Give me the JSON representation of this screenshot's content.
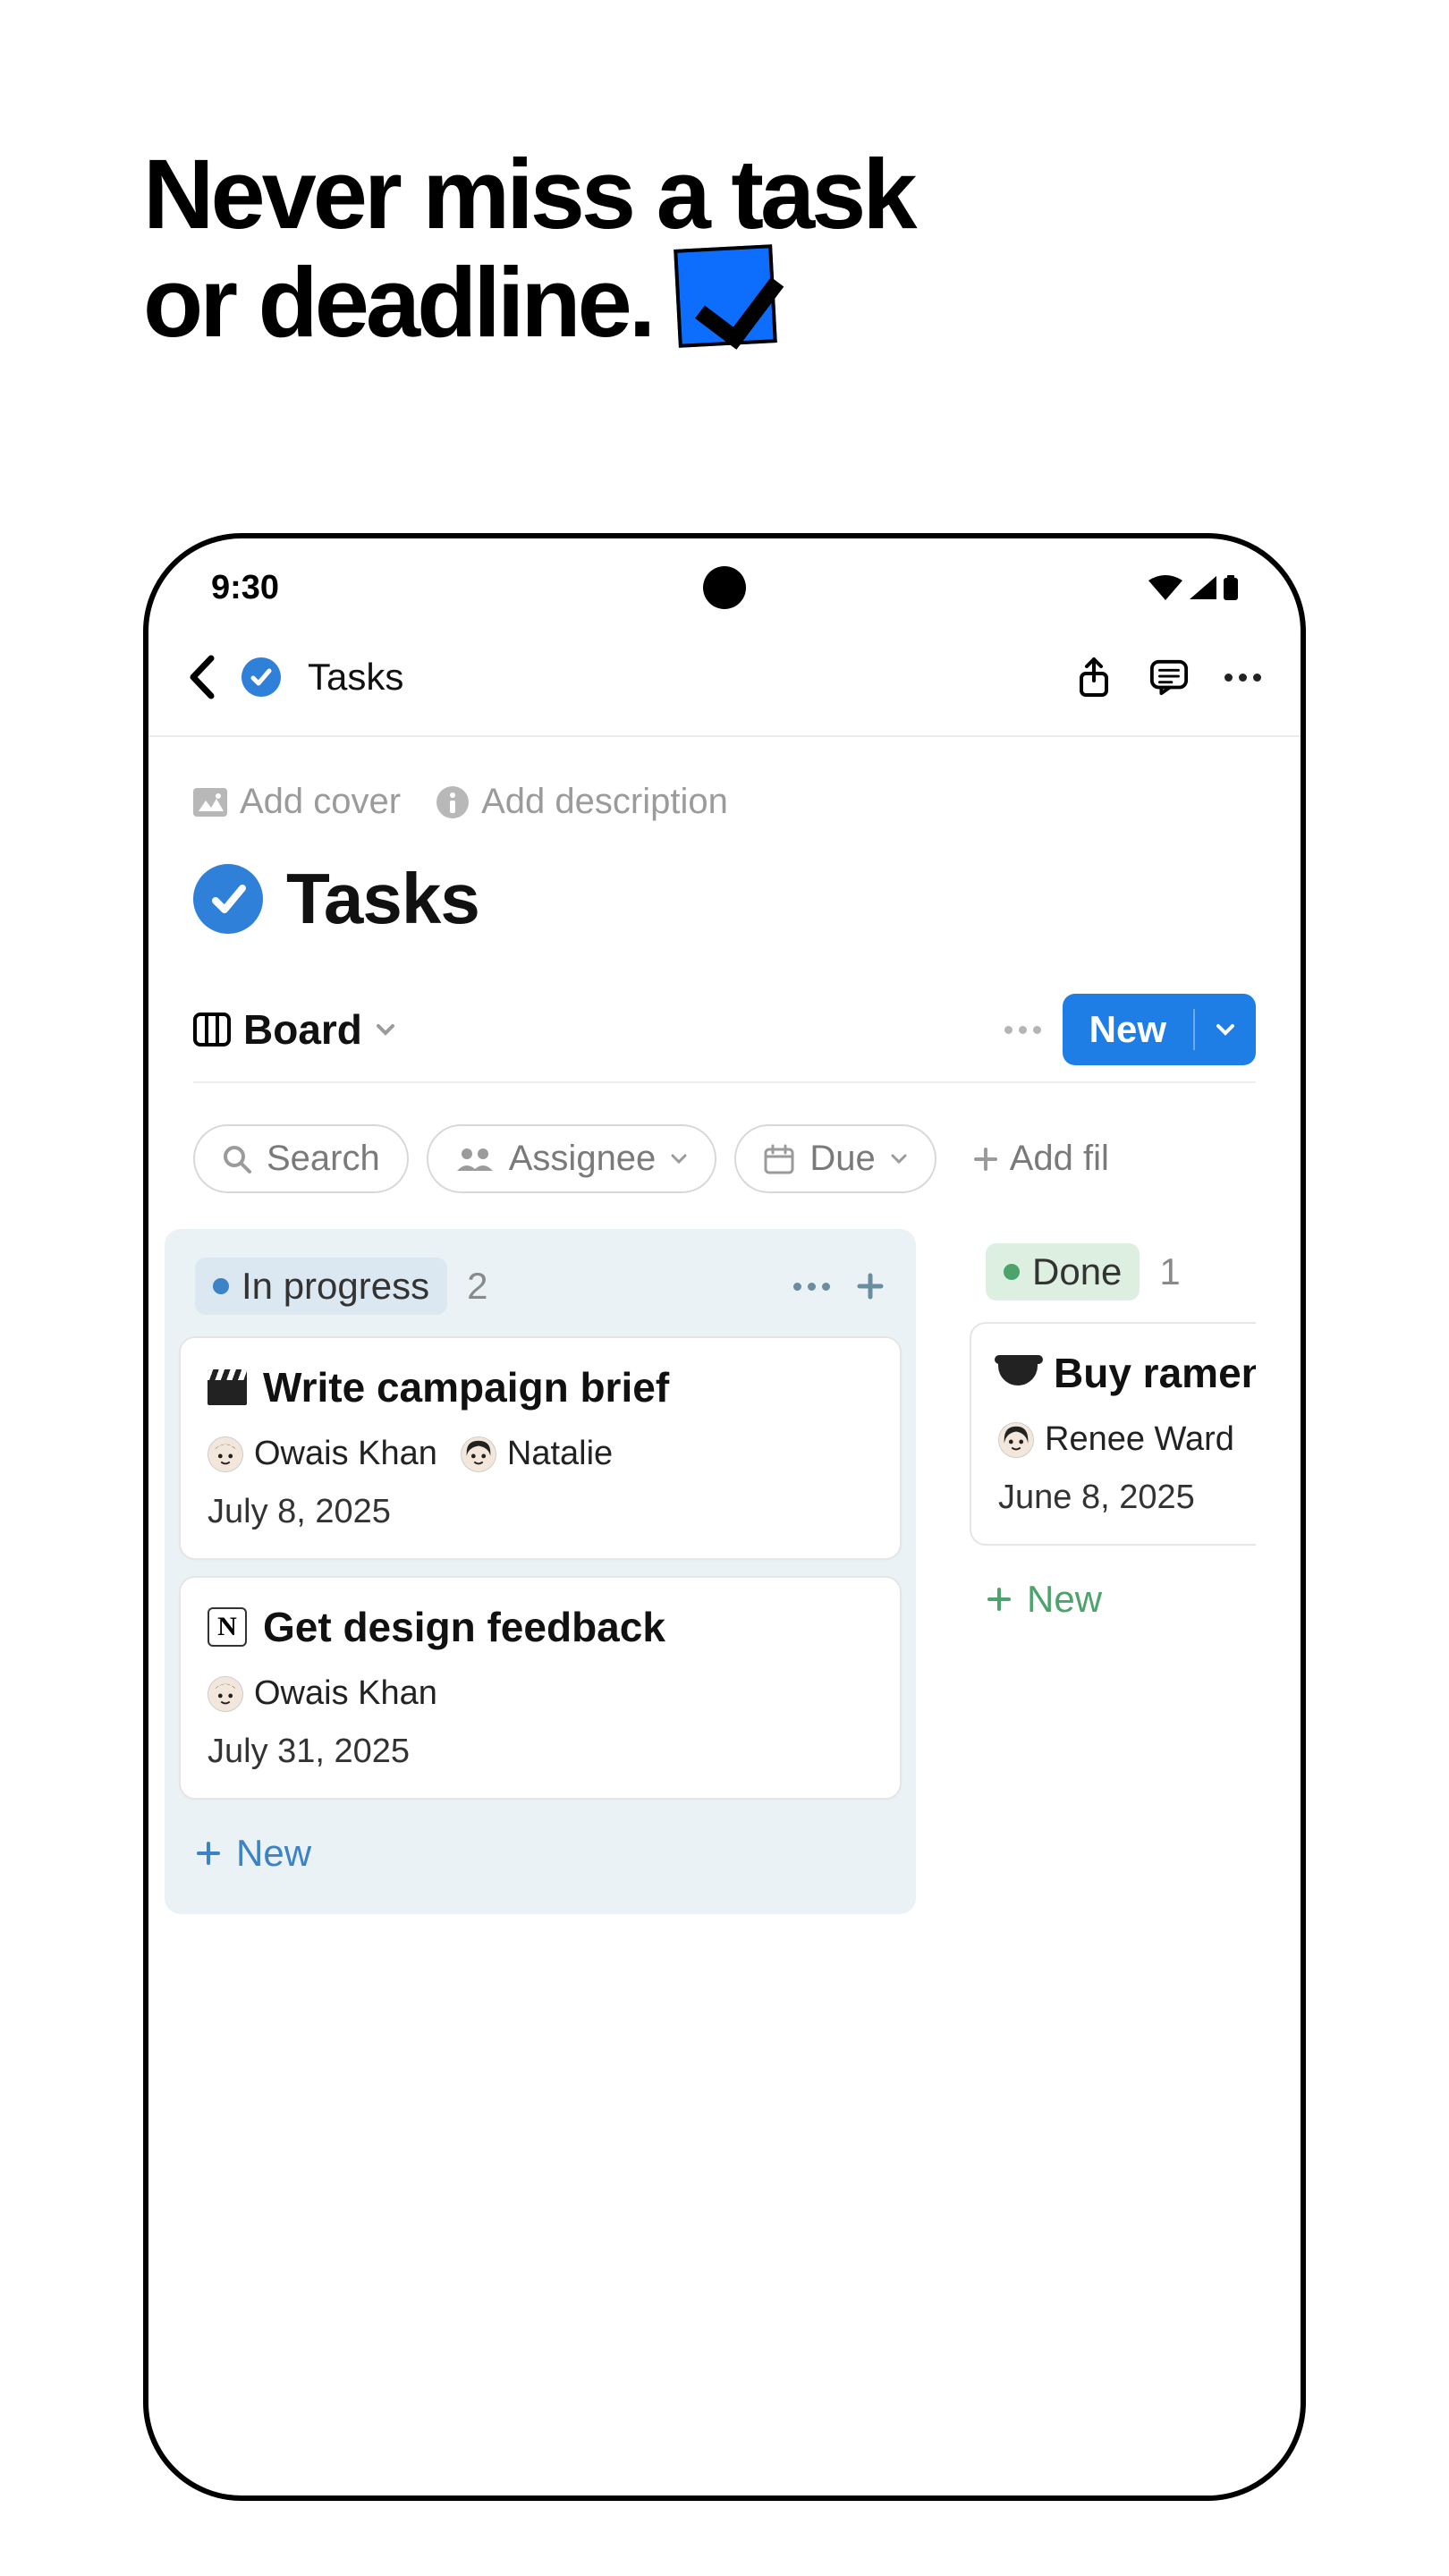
{
  "headline": {
    "line1": "Never miss a task",
    "line2": "or deadline."
  },
  "status_bar": {
    "time": "9:30"
  },
  "header": {
    "breadcrumb_title": "Tasks"
  },
  "meta": {
    "add_cover": "Add cover",
    "add_description": "Add description"
  },
  "page": {
    "title": "Tasks"
  },
  "view": {
    "name": "Board",
    "new_label": "New"
  },
  "filters": {
    "search": "Search",
    "assignee": "Assignee",
    "due": "Due",
    "add_filter": "Add fil"
  },
  "columns": [
    {
      "key": "in_progress",
      "label": "In progress",
      "count": "2",
      "color": "blue",
      "cards": [
        {
          "icon": "clapper",
          "title": "Write campaign brief",
          "assignees": [
            {
              "name": "Owais Khan",
              "avatar": "m1"
            },
            {
              "name": "Natalie",
              "avatar": "f1"
            }
          ],
          "date": "July 8, 2025"
        },
        {
          "icon": "notion",
          "title": "Get design feedback",
          "assignees": [
            {
              "name": "Owais Khan",
              "avatar": "m1"
            }
          ],
          "date": "July 31, 2025"
        }
      ],
      "new_label": "New"
    },
    {
      "key": "done",
      "label": "Done",
      "count": "1",
      "color": "green",
      "cards": [
        {
          "icon": "bowl",
          "title": "Buy ramen",
          "assignees": [
            {
              "name": "Renee Ward",
              "avatar": "f2"
            }
          ],
          "date": "June 8, 2025"
        }
      ],
      "new_label": "New"
    }
  ]
}
